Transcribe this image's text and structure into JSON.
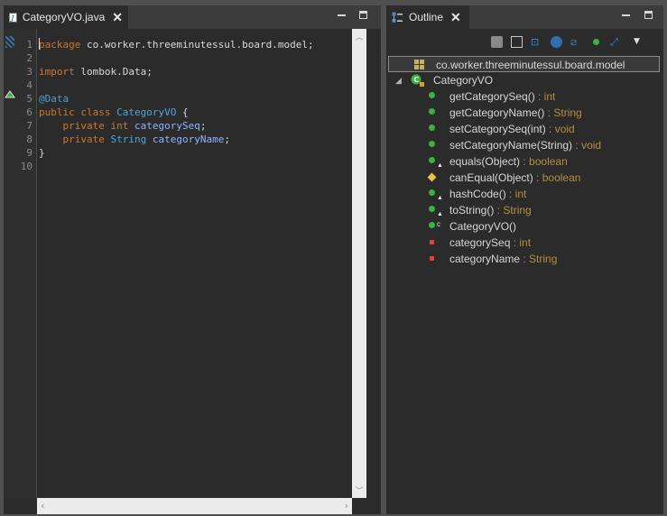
{
  "editor": {
    "tab_title": "CategoryVO.java",
    "close_glyph": "✕",
    "line_numbers": [
      "1",
      "2",
      "3",
      "4",
      "5",
      "6",
      "7",
      "8",
      "9",
      "10"
    ],
    "lines": [
      [
        {
          "t": "package",
          "c": "kw"
        },
        {
          "t": " co.worker.threeminutessul.board.model;",
          "c": ""
        }
      ],
      [],
      [
        {
          "t": "import",
          "c": "kw"
        },
        {
          "t": " lombok.Data;",
          "c": ""
        }
      ],
      [],
      [
        {
          "t": "@Data",
          "c": "ann"
        }
      ],
      [
        {
          "t": "public",
          "c": "kw"
        },
        {
          "t": " ",
          "c": ""
        },
        {
          "t": "class",
          "c": "kw"
        },
        {
          "t": " ",
          "c": ""
        },
        {
          "t": "CategoryVO",
          "c": "cls"
        },
        {
          "t": " {",
          "c": ""
        }
      ],
      [
        {
          "t": "    ",
          "c": ""
        },
        {
          "t": "private",
          "c": "kw"
        },
        {
          "t": " ",
          "c": ""
        },
        {
          "t": "int",
          "c": "kw"
        },
        {
          "t": " ",
          "c": ""
        },
        {
          "t": "categorySeq",
          "c": "fld"
        },
        {
          "t": ";",
          "c": ""
        }
      ],
      [
        {
          "t": "    ",
          "c": ""
        },
        {
          "t": "private",
          "c": "kw"
        },
        {
          "t": " ",
          "c": ""
        },
        {
          "t": "String",
          "c": "cls"
        },
        {
          "t": " ",
          "c": ""
        },
        {
          "t": "categoryName",
          "c": "fld"
        },
        {
          "t": ";",
          "c": ""
        }
      ],
      [
        {
          "t": "}",
          "c": ""
        }
      ],
      []
    ]
  },
  "outline": {
    "tab_title": "Outline",
    "close_glyph": "✕",
    "package_row": "co.worker.threeminutessul.board.model",
    "class_row": "CategoryVO",
    "members": [
      {
        "name": "getCategorySeq()",
        "type": " : int",
        "icon": "public-method-icon",
        "overlay": ""
      },
      {
        "name": "getCategoryName()",
        "type": " : String",
        "icon": "public-method-icon",
        "overlay": ""
      },
      {
        "name": "setCategorySeq(int)",
        "type": " : void",
        "icon": "public-method-icon",
        "overlay": ""
      },
      {
        "name": "setCategoryName(String)",
        "type": " : void",
        "icon": "public-method-icon",
        "overlay": ""
      },
      {
        "name": "equals(Object)",
        "type": " : boolean",
        "icon": "public-method-icon",
        "overlay": "override-overlay-icon"
      },
      {
        "name": "canEqual(Object)",
        "type": " : boolean",
        "icon": "protected-method-icon",
        "overlay": ""
      },
      {
        "name": "hashCode()",
        "type": " : int",
        "icon": "public-method-icon",
        "overlay": "override-overlay-icon"
      },
      {
        "name": "toString()",
        "type": " : String",
        "icon": "public-method-icon",
        "overlay": "override-overlay-icon"
      },
      {
        "name": "CategoryVO()",
        "type": "",
        "icon": "public-method-icon",
        "overlay": "constructor-overlay-icon"
      },
      {
        "name": "categorySeq",
        "type": " : int",
        "icon": "private-field-icon",
        "overlay": ""
      },
      {
        "name": "categoryName",
        "type": " : String",
        "icon": "private-field-icon",
        "overlay": ""
      }
    ]
  },
  "colors": {
    "keyword": "#cc7832",
    "annotation": "#4a9fd6",
    "type": "#4ea6dc",
    "field": "#8fb4ff",
    "return_type": "#b38f3c",
    "public_method": "#3cb043",
    "private_field": "#e04040",
    "protected_method": "#e8c14a"
  }
}
